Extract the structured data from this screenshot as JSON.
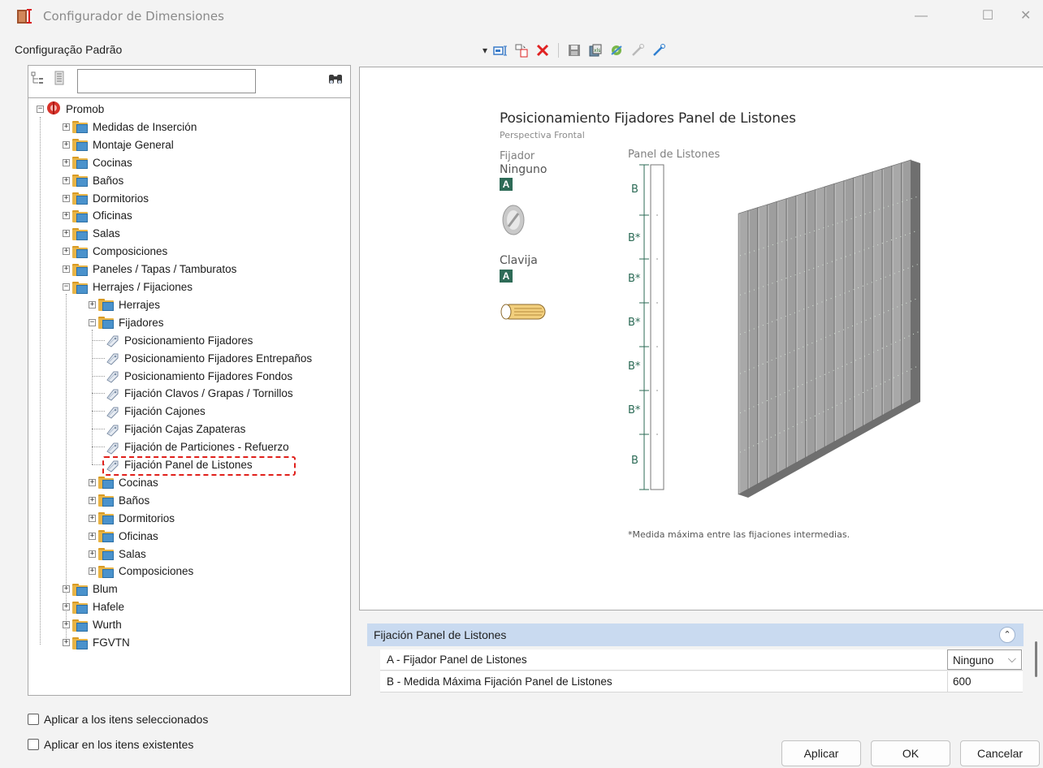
{
  "window": {
    "title": "Configurador de Dimensiones",
    "minimize": "—",
    "maximize": "☐",
    "close": "✕"
  },
  "config_name": "Configuração Padrão",
  "tree": {
    "search_placeholder": "",
    "nodes": [
      {
        "label": "Promob",
        "depth": 0,
        "kind": "root",
        "expander": "−"
      },
      {
        "label": "Medidas de Inserción",
        "depth": 1,
        "kind": "folder",
        "expander": "+"
      },
      {
        "label": "Montaje General",
        "depth": 1,
        "kind": "folder",
        "expander": "+"
      },
      {
        "label": "Cocinas",
        "depth": 1,
        "kind": "folder",
        "expander": "+"
      },
      {
        "label": "Baños",
        "depth": 1,
        "kind": "folder",
        "expander": "+"
      },
      {
        "label": "Dormitorios",
        "depth": 1,
        "kind": "folder",
        "expander": "+"
      },
      {
        "label": "Oficinas",
        "depth": 1,
        "kind": "folder",
        "expander": "+"
      },
      {
        "label": "Salas",
        "depth": 1,
        "kind": "folder",
        "expander": "+"
      },
      {
        "label": "Composiciones",
        "depth": 1,
        "kind": "folder",
        "expander": "+"
      },
      {
        "label": "Paneles / Tapas / Tamburatos",
        "depth": 1,
        "kind": "folder",
        "expander": "+"
      },
      {
        "label": "Herrajes / Fijaciones",
        "depth": 1,
        "kind": "folder",
        "expander": "−"
      },
      {
        "label": "Herrajes",
        "depth": 2,
        "kind": "folder",
        "expander": "+"
      },
      {
        "label": "Fijadores",
        "depth": 2,
        "kind": "folder",
        "expander": "−"
      },
      {
        "label": "Posicionamiento Fijadores",
        "depth": 3,
        "kind": "item"
      },
      {
        "label": "Posicionamiento Fijadores Entrepaños",
        "depth": 3,
        "kind": "item"
      },
      {
        "label": "Posicionamiento Fijadores Fondos",
        "depth": 3,
        "kind": "item"
      },
      {
        "label": "Fijación Clavos / Grapas / Tornillos",
        "depth": 3,
        "kind": "item"
      },
      {
        "label": "Fijación Cajones",
        "depth": 3,
        "kind": "item"
      },
      {
        "label": "Fijación Cajas Zapateras",
        "depth": 3,
        "kind": "item"
      },
      {
        "label": "Fijación de Particiones - Refuerzo",
        "depth": 3,
        "kind": "item"
      },
      {
        "label": "Fijación Panel de Listones",
        "depth": 3,
        "kind": "item",
        "highlighted": true
      },
      {
        "label": "Cocinas",
        "depth": 2,
        "kind": "folder",
        "expander": "+"
      },
      {
        "label": "Baños",
        "depth": 2,
        "kind": "folder",
        "expander": "+"
      },
      {
        "label": "Dormitorios",
        "depth": 2,
        "kind": "folder",
        "expander": "+"
      },
      {
        "label": "Oficinas",
        "depth": 2,
        "kind": "folder",
        "expander": "+"
      },
      {
        "label": "Salas",
        "depth": 2,
        "kind": "folder",
        "expander": "+"
      },
      {
        "label": "Composiciones",
        "depth": 2,
        "kind": "folder",
        "expander": "+"
      },
      {
        "label": "Blum",
        "depth": 1,
        "kind": "folder",
        "expander": "+"
      },
      {
        "label": "Hafele",
        "depth": 1,
        "kind": "folder",
        "expander": "+"
      },
      {
        "label": "Wurth",
        "depth": 1,
        "kind": "folder",
        "expander": "+"
      },
      {
        "label": "FGVTN",
        "depth": 1,
        "kind": "folder",
        "expander": "+"
      }
    ]
  },
  "options": {
    "apply_selected": "Aplicar a los itens seleccionados",
    "apply_existing": "Aplicar en los itens existentes"
  },
  "preview": {
    "title": "Posicionamiento Fijadores Panel de Listones",
    "subtitle": "Perspectiva Frontal",
    "fijador_label": "Fijador",
    "fijador_value": "Ninguno",
    "badge": "A",
    "clavija_label": "Clavija",
    "panel_label": "Panel de Listones",
    "dim_labels": [
      "B",
      "B*",
      "B*",
      "B*",
      "B*",
      "B*",
      "B"
    ],
    "note": "*Medida máxima entre las fijaciones intermedias."
  },
  "properties": {
    "section_title": "Fijación Panel de Listones",
    "collapse_icon": "⌃",
    "rows": [
      {
        "label": "A - Fijador Panel de Listones",
        "value": "Ninguno",
        "dropdown": "⌵"
      },
      {
        "label": "B - Medida Máxima Fijación Panel de Listones",
        "value": "600"
      }
    ]
  },
  "buttons": {
    "apply": "Aplicar",
    "ok": "OK",
    "cancel": "Cancelar"
  },
  "toolbar": {
    "dropdown_arrow": "▾",
    "icons": [
      "properties-icon",
      "copy-icon",
      "delete-icon",
      "save-icon",
      "export-icon",
      "settings-icon",
      "link-icon",
      "edit-icon"
    ]
  },
  "colors": {
    "accent_badge": "#2e6b57",
    "section_header": "#c9daf0",
    "highlight": "#e0201b"
  }
}
